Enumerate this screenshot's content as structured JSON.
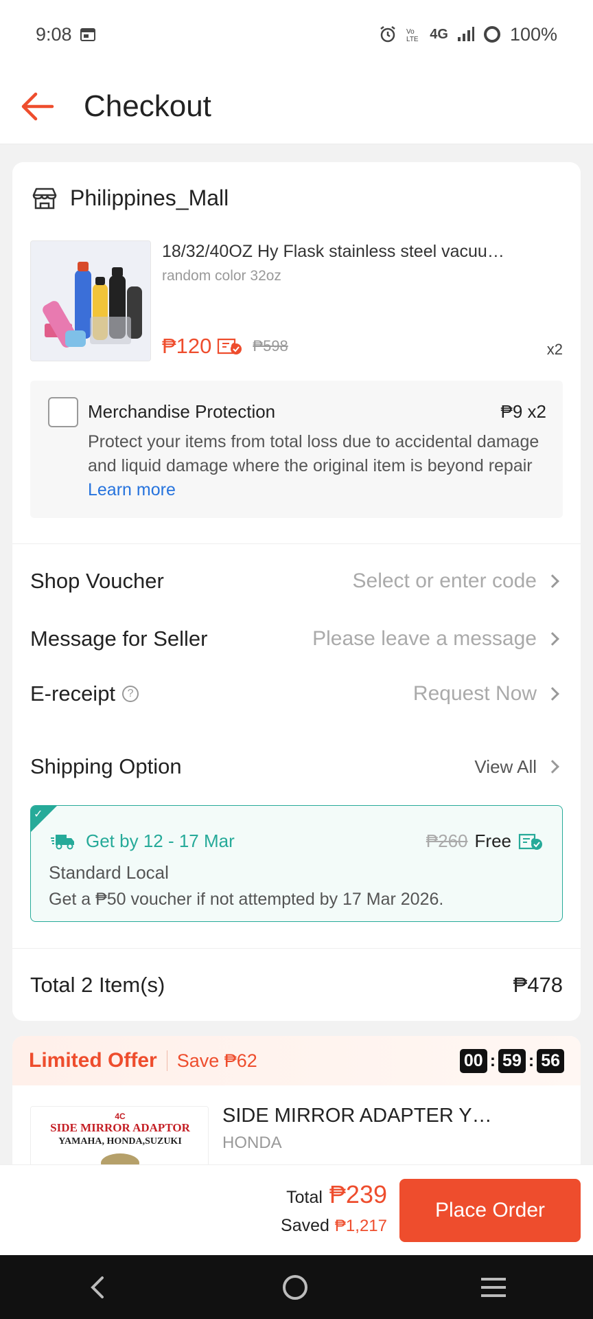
{
  "status_bar": {
    "time": "9:08",
    "network": "4G",
    "battery": "100%"
  },
  "header": {
    "title": "Checkout"
  },
  "shop": {
    "name": "Philippines_Mall",
    "product": {
      "title": "18/32/40OZ Hy Flask stainless steel vacuu…",
      "variant": "random color 32oz",
      "price": "₱120",
      "original_price": "₱598",
      "quantity": "x2"
    },
    "protection": {
      "title": "Merchandise Protection",
      "price": "₱9  x2",
      "description": "Protect your items from total loss due to accidental damage and liquid damage where the original item is beyond repair",
      "link": "Learn more",
      "checked": false
    },
    "rows": {
      "voucher_label": "Shop Voucher",
      "voucher_placeholder": "Select or enter code",
      "message_label": "Message for Seller",
      "message_placeholder": "Please leave a message",
      "ereceipt_label": "E-receipt",
      "ereceipt_action": "Request Now"
    },
    "shipping": {
      "label": "Shipping Option",
      "view_all": "View All",
      "eta": "Get by 12 - 17 Mar",
      "original_fee": "₱260",
      "fee": "Free",
      "type": "Standard Local",
      "note": "Get a ₱50 voucher if not attempted by 17 Mar 2026."
    },
    "total_label": "Total 2 Item(s)",
    "total_value": "₱478"
  },
  "offer": {
    "title": "Limited Offer",
    "save": "Save ₱62",
    "timer": [
      "00",
      "59",
      "56"
    ],
    "product_name": "SIDE MIRROR ADAPTER Y…",
    "brand": "HONDA",
    "image_text_1": "SIDE MIRROR ADAPTOR",
    "image_text_2": "YAMAHA, HONDA,SUZUKI"
  },
  "bottom": {
    "total_label": "Total",
    "total_amount": "₱239",
    "saved_label": "Saved",
    "saved_amount": "₱1,217",
    "place_order": "Place Order"
  },
  "colors": {
    "accent": "#ee4d2d",
    "shipping": "#26aa99",
    "link": "#2673dd"
  }
}
